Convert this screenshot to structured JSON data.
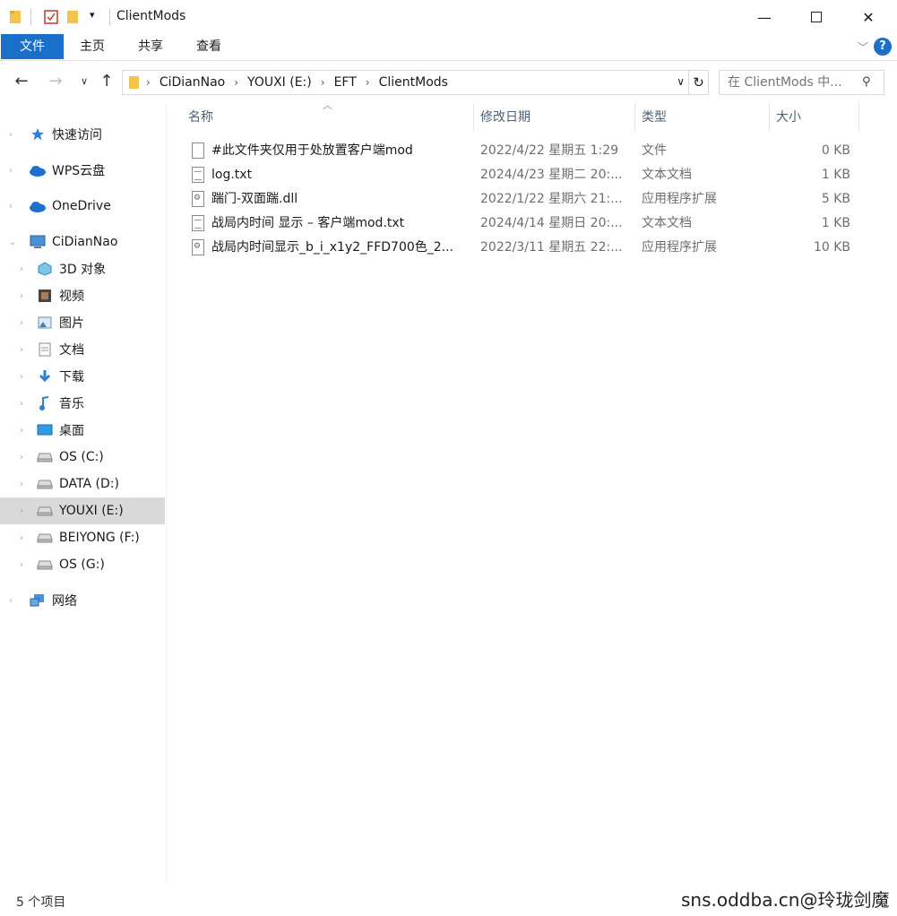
{
  "window": {
    "title": "ClientMods"
  },
  "ribbon": {
    "tabs": [
      "文件",
      "主页",
      "共享",
      "查看"
    ],
    "help_label": "?"
  },
  "address": {
    "crumbs": [
      "CiDianNao",
      "YOUXI (E:)",
      "EFT",
      "ClientMods"
    ],
    "search_placeholder": "在 ClientMods 中..."
  },
  "sidebar": {
    "items": [
      {
        "label": "快速访问",
        "icon": "star-icon"
      },
      {
        "label": "WPS云盘",
        "icon": "cloud-icon"
      },
      {
        "label": "OneDrive",
        "icon": "cloud-icon"
      },
      {
        "label": "CiDianNao",
        "icon": "computer-icon"
      },
      {
        "label": "3D 对象",
        "icon": "cube-icon"
      },
      {
        "label": "视频",
        "icon": "video-icon"
      },
      {
        "label": "图片",
        "icon": "picture-icon"
      },
      {
        "label": "文档",
        "icon": "document-icon"
      },
      {
        "label": "下载",
        "icon": "download-icon"
      },
      {
        "label": "音乐",
        "icon": "music-icon"
      },
      {
        "label": "桌面",
        "icon": "desktop-icon"
      },
      {
        "label": "OS (C:)",
        "icon": "drive-icon"
      },
      {
        "label": "DATA (D:)",
        "icon": "drive-icon"
      },
      {
        "label": "YOUXI (E:)",
        "icon": "drive-icon"
      },
      {
        "label": "BEIYONG (F:)",
        "icon": "drive-icon"
      },
      {
        "label": "OS (G:)",
        "icon": "drive-icon"
      },
      {
        "label": "网络",
        "icon": "network-icon"
      }
    ]
  },
  "columns": {
    "name": "名称",
    "date": "修改日期",
    "type": "类型",
    "size": "大小"
  },
  "files": [
    {
      "name": "#此文件夹仅用于处放置客户端mod",
      "date": "2022/4/22 星期五 1:29",
      "type": "文件",
      "size": "0 KB",
      "kind": "blank"
    },
    {
      "name": "log.txt",
      "date": "2024/4/23 星期二 20:...",
      "type": "文本文档",
      "size": "1 KB",
      "kind": "txt"
    },
    {
      "name": "踹门-双面踹.dll",
      "date": "2022/1/22 星期六 21:...",
      "type": "应用程序扩展",
      "size": "5 KB",
      "kind": "dll"
    },
    {
      "name": "战局内时间 显示 – 客户端mod.txt",
      "date": "2024/4/14 星期日 20:...",
      "type": "文本文档",
      "size": "1 KB",
      "kind": "txt"
    },
    {
      "name": "战局内时间显示_b_i_x1y2_FFD700色_2...",
      "date": "2022/3/11 星期五 22:...",
      "type": "应用程序扩展",
      "size": "10 KB",
      "kind": "dll"
    }
  ],
  "status": {
    "count": "5 个项目"
  },
  "watermark": "sns.oddba.cn@玲珑剑魔"
}
